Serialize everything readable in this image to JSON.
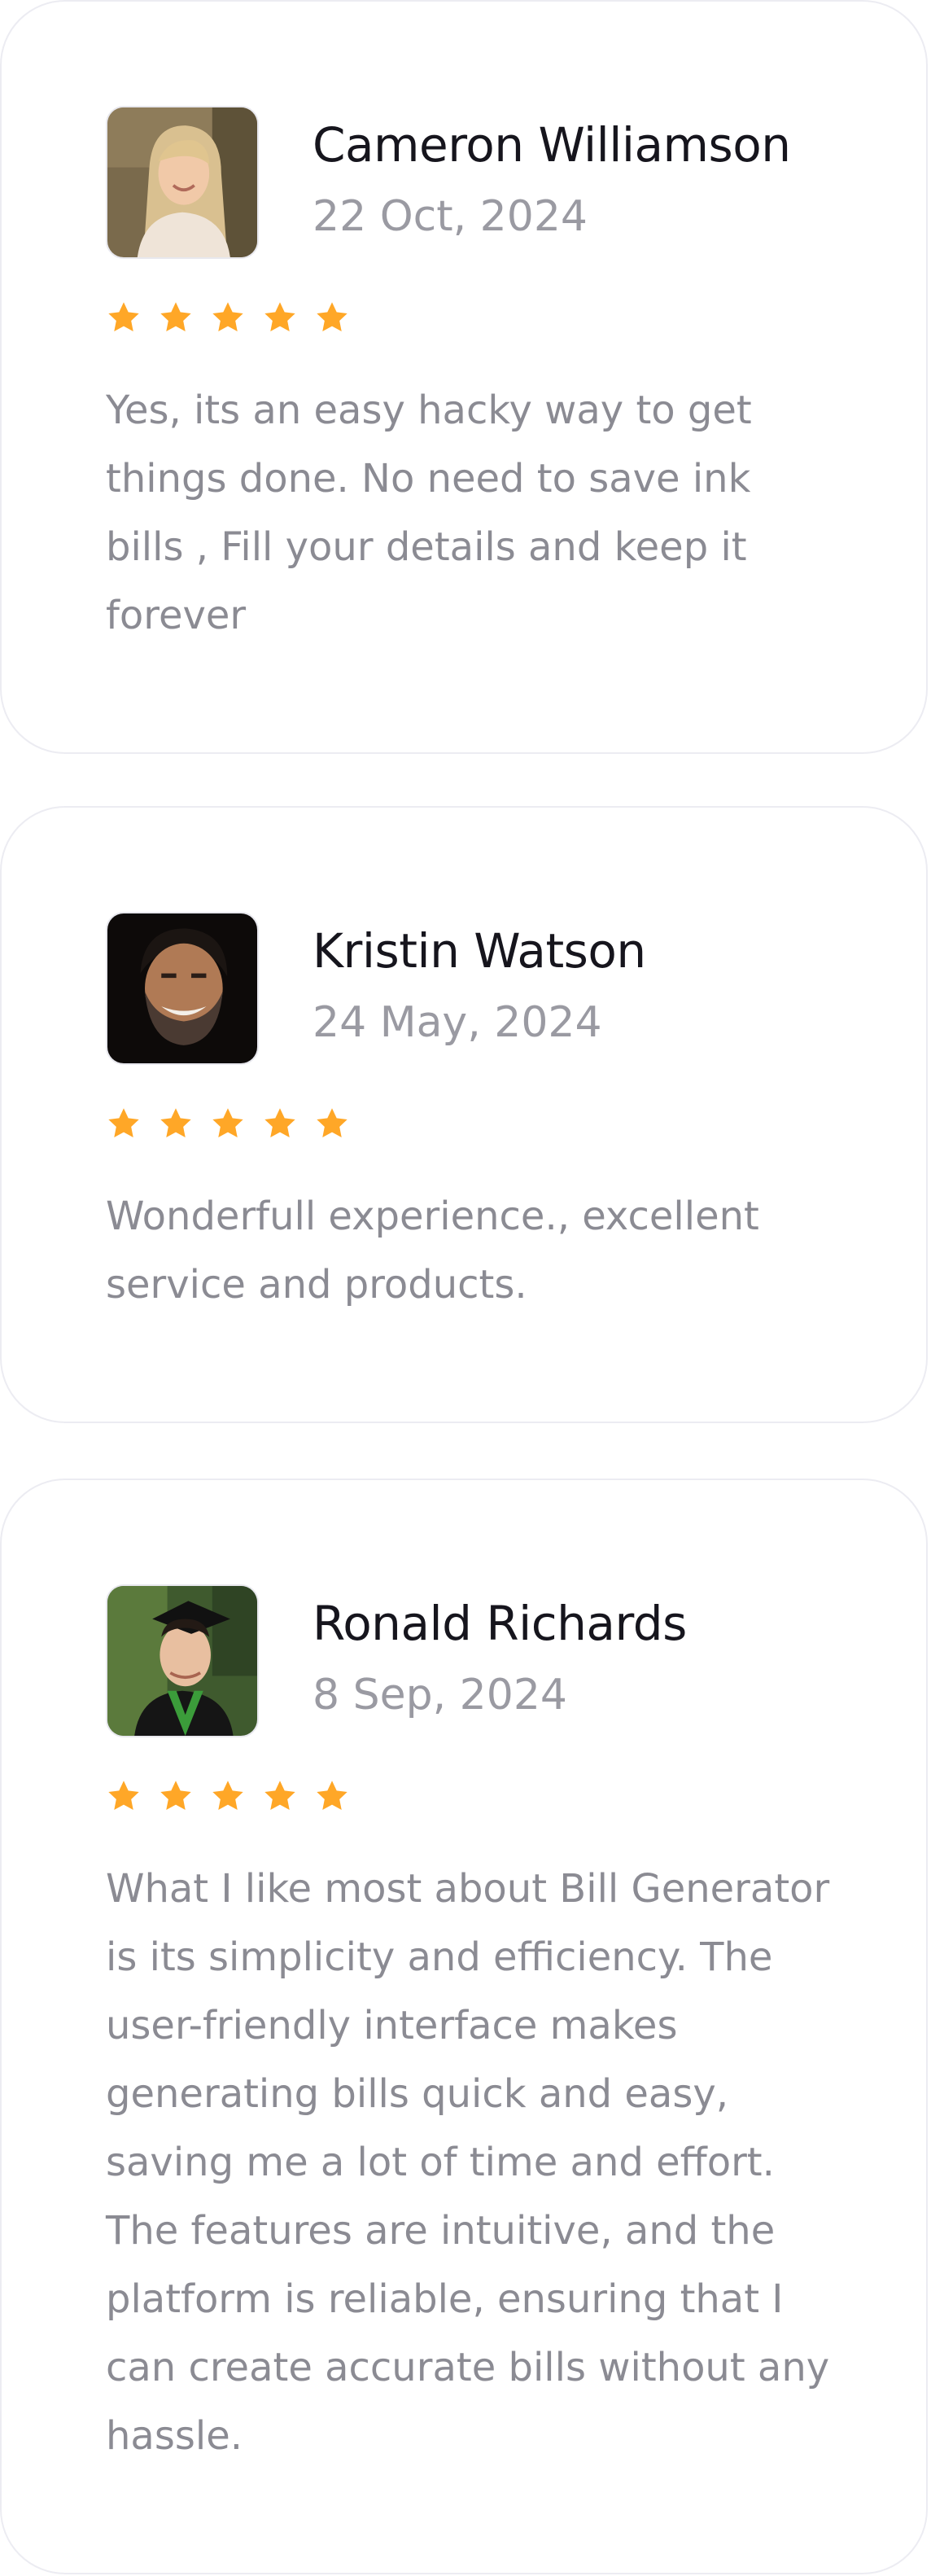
{
  "colors": {
    "star": "#FFA727",
    "name": "#16151D",
    "muted": "#8B8B93",
    "border": "#ECECF2"
  },
  "reviews": [
    {
      "name": "Cameron Williamson",
      "date": "22 Oct, 2024",
      "rating": 5,
      "avatar_icon": "avatar-woman-blonde",
      "text": "Yes, its an easy hacky way to get things done. No need to save ink bills , Fill your details and keep it forever"
    },
    {
      "name": "Kristin Watson",
      "date": "24 May, 2024",
      "rating": 5,
      "avatar_icon": "avatar-man-beard",
      "text": "Wonderfull experience., excellent service and products."
    },
    {
      "name": "Ronald Richards",
      "date": "8 Sep, 2024",
      "rating": 5,
      "avatar_icon": "avatar-man-graduate",
      "text": "What I like most about Bill Generator is its simplicity and efficiency. The user-friendly interface makes generating bills quick and easy, saving me a lot of time and effort. The features are intuitive, and the platform is reliable, ensuring that I can create accurate bills without any hassle."
    }
  ]
}
